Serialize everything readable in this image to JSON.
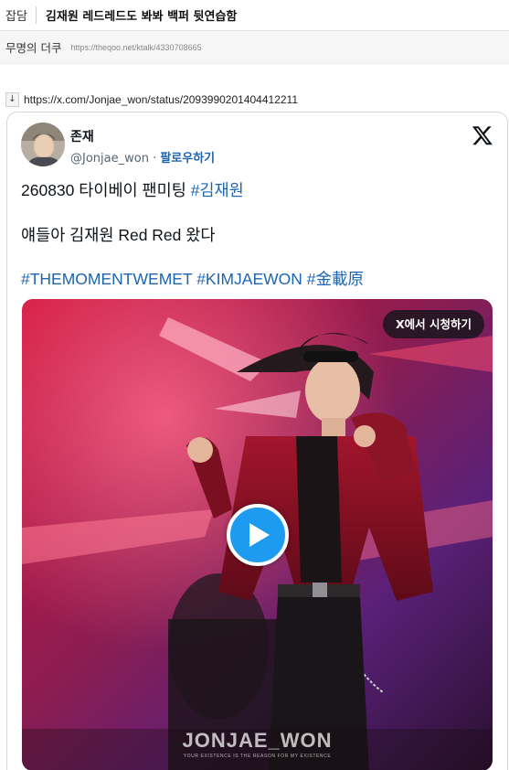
{
  "post": {
    "category": "잡담",
    "title": "김재원 레드레드도 봐봐 백퍼 뒷연습함",
    "author": "무명의 더쿠",
    "url": "https://theqoo.net/ktalk/4330708665"
  },
  "link": {
    "arrow": "↓",
    "url": "https://x.com/Jonjae_won/status/2093990201404412211"
  },
  "tweet": {
    "author_name": "존재",
    "handle": "@Jonjae_won",
    "separator": " · ",
    "follow_label": "팔로우하기",
    "line1_text": "260830 타이베이 팬미팅 ",
    "line1_hashtag": "#김재원",
    "line2_text": "얘들아 김재원 Red Red 왔다",
    "hashtags": [
      "#THEMOMENTWEMET",
      "#KIMJAEWON",
      "#金載原"
    ],
    "watch_label": "X에서 시청하기",
    "watermark": "JONJAE_WON",
    "watermark_sub": "YOUR EXISTENCE IS THE REASON FOR MY EXISTENCE"
  },
  "colors": {
    "link_blue": "#1d65b0",
    "play_button": "#1d9bf0",
    "stage_red": "#c2183e"
  },
  "icons": {
    "x_logo": "x-logo-icon",
    "play": "play-icon",
    "download": "down-arrow-icon"
  }
}
